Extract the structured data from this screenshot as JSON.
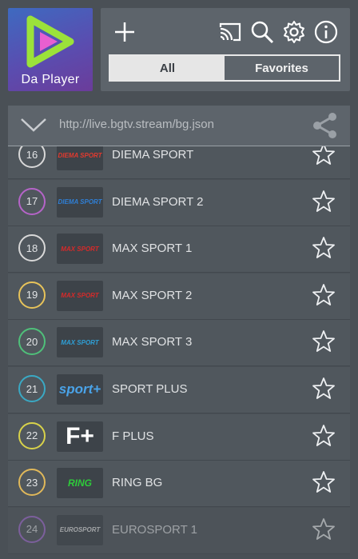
{
  "app": {
    "name": "Da Player"
  },
  "toolbar": {
    "icons": [
      "add-icon",
      "cast-icon",
      "search-icon",
      "gear-icon",
      "info-icon"
    ]
  },
  "tabs": [
    {
      "label": "All",
      "active": true
    },
    {
      "label": "Favorites",
      "active": false
    }
  ],
  "playlist": {
    "url": "http://live.bgtv.stream/bg.json"
  },
  "channels": [
    {
      "number": "16",
      "name": "DIEMA SPORT",
      "ring": "#d8d8d8",
      "logo": "DIEMA SPORT",
      "logo_color": "#e23a2f"
    },
    {
      "number": "17",
      "name": "DIEMA SPORT 2",
      "ring": "#b564c8",
      "logo": "DIEMA SPORT",
      "logo_color": "#2f7fd6"
    },
    {
      "number": "18",
      "name": "MAX SPORT 1",
      "ring": "#d8d8d8",
      "logo": "MAX SPORT",
      "logo_color": "#d52a2a"
    },
    {
      "number": "19",
      "name": "MAX SPORT 2",
      "ring": "#e7c35a",
      "logo": "MAX SPORT",
      "logo_color": "#d52a2a"
    },
    {
      "number": "20",
      "name": "MAX SPORT 3",
      "ring": "#4fc07a",
      "logo": "MAX SPORT",
      "logo_color": "#2e9fd6"
    },
    {
      "number": "21",
      "name": "SPORT PLUS",
      "ring": "#3aa9c4",
      "logo": "sport+",
      "logo_color": "#4aa3e8"
    },
    {
      "number": "22",
      "name": "F PLUS",
      "ring": "#d8d24a",
      "logo": "F+",
      "logo_color": "#ffffff"
    },
    {
      "number": "23",
      "name": "RING BG",
      "ring": "#e0b85a",
      "logo": "RING",
      "logo_color": "#2ecc3a"
    },
    {
      "number": "24",
      "name": "EUROSPORT 1",
      "ring": "#a56cd6",
      "logo": "EUROSPORT",
      "logo_color": "#e7e7e7"
    }
  ]
}
